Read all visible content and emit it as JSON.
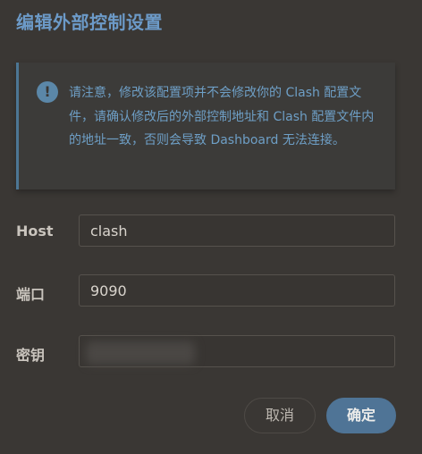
{
  "dialog": {
    "title": "编辑外部控制设置"
  },
  "notice": {
    "icon": "exclamation-icon",
    "icon_glyph": "!",
    "text": "请注意，修改该配置项并不会修改你的 Clash 配置文件，请确认修改后的外部控制地址和 Clash 配置文件内的地址一致，否则会导致 Dashboard 无法连接。"
  },
  "form": {
    "host_label": "Host",
    "host_value": "clash",
    "port_label": "端口",
    "port_value": "9090",
    "secret_label": "密钥",
    "secret_value": ""
  },
  "buttons": {
    "cancel_label": "取消",
    "ok_label": "确定"
  },
  "colors": {
    "background": "#3a3734",
    "accent": "#4f7496",
    "title": "#6c9ac8",
    "notice_text": "#6e9fc6"
  }
}
